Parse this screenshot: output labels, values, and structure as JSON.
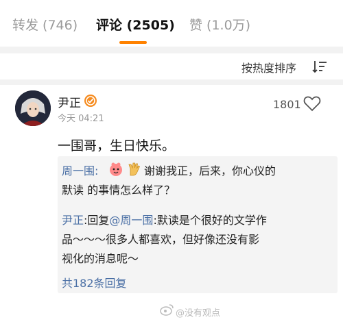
{
  "tabs": [
    {
      "label": "转发 (746)"
    },
    {
      "label": "评论 (2505)"
    },
    {
      "label": "赞 (1.0万)"
    }
  ],
  "active_tab_index": 1,
  "accent_color": "#ff8200",
  "link_color": "#4a6fa5",
  "sort": {
    "label": "按热度排序",
    "icon": "sort-icon"
  },
  "comment": {
    "author": "尹正",
    "verified_icon": "verified-badge-icon",
    "time": "今天 04:21",
    "likes": "1801",
    "text": "一围哥，生日快乐。",
    "replies": [
      {
        "name": "周一围:",
        "emojis": [
          "cute-emoji",
          "ok-hand-emoji"
        ],
        "line1": "谢谢我正，后来，你心仪的",
        "line2": "默读 的事情怎么样了？"
      },
      {
        "name": "尹正",
        "action": ":回复",
        "mention": "@周一围",
        "line1_rest": ":默读是个很好的文学作",
        "line2": "品～～～很多人都喜欢，但好像还没有影",
        "line3": "视化的消息呢～"
      }
    ],
    "more_replies": "共182条回复"
  },
  "watermark": "@没有观点"
}
